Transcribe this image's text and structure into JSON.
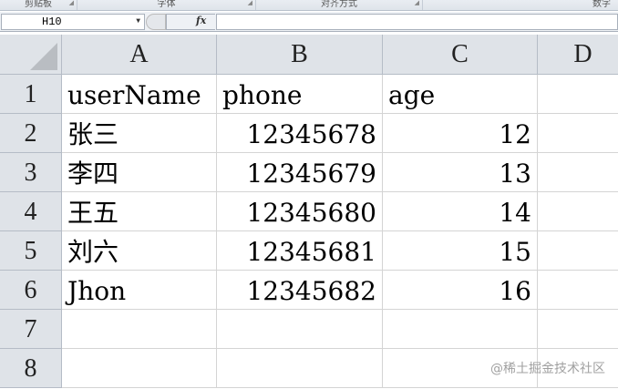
{
  "ribbon": {
    "groups": [
      "剪贴板",
      "字体",
      "对齐方式",
      "数字"
    ]
  },
  "formula_bar": {
    "name_box": "H10",
    "fx_label": "fx",
    "value": ""
  },
  "columns": [
    "A",
    "B",
    "C",
    "D"
  ],
  "rows": [
    "1",
    "2",
    "3",
    "4",
    "5",
    "6",
    "7",
    "8"
  ],
  "cells": [
    [
      "userName",
      "phone",
      "age"
    ],
    [
      "张三",
      "12345678",
      "12"
    ],
    [
      "李四",
      "12345679",
      "13"
    ],
    [
      "王五",
      "12345680",
      "14"
    ],
    [
      "刘六",
      "12345681",
      "15"
    ],
    [
      "Jhon",
      "12345682",
      "16"
    ],
    [
      "",
      "",
      ""
    ],
    [
      "",
      "",
      ""
    ]
  ],
  "watermark": "@稀土掘金技术社区"
}
